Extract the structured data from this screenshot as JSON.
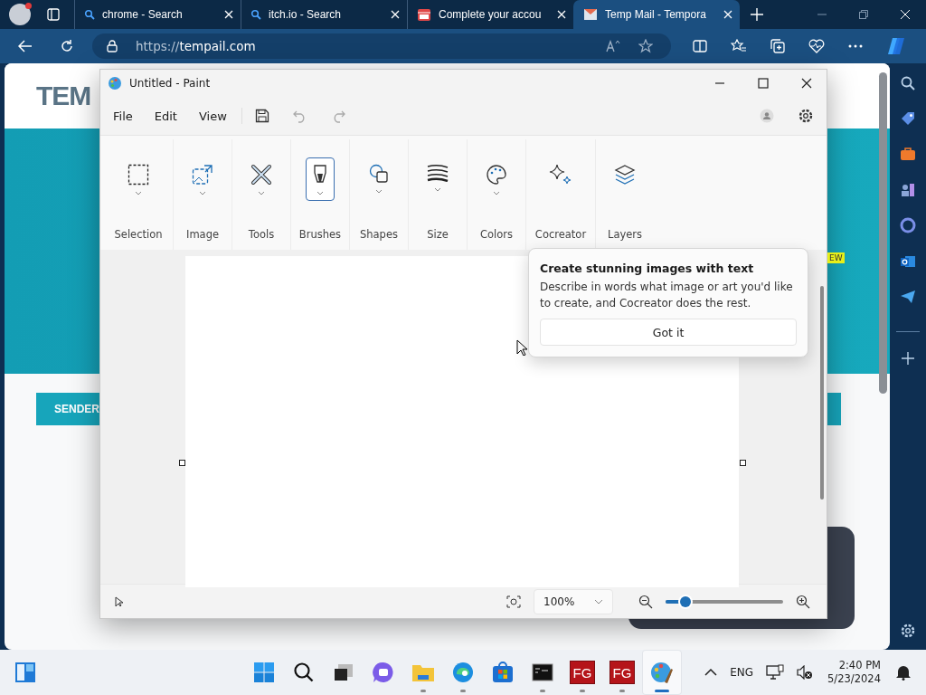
{
  "browser": {
    "tabs": [
      {
        "title": "chrome - Search",
        "kind": "search",
        "selected": false
      },
      {
        "title": "itch.io - Search",
        "kind": "search",
        "selected": false
      },
      {
        "title": "Complete your accou",
        "kind": "store",
        "selected": false
      },
      {
        "title": "Temp Mail - Tempora",
        "kind": "mail",
        "selected": true
      }
    ],
    "address": {
      "scheme": "https://",
      "host": "tempail.com"
    },
    "page": {
      "logo": "TEM",
      "column_header": "SENDER",
      "badge": "EW"
    }
  },
  "paint": {
    "title": "Untitled - Paint",
    "menu": [
      "File",
      "Edit",
      "View"
    ],
    "tools": [
      {
        "label": "Selection",
        "kind": "selection",
        "dropdown": true,
        "selected": false
      },
      {
        "label": "Image",
        "kind": "image",
        "dropdown": true,
        "selected": false
      },
      {
        "label": "Tools",
        "kind": "tools",
        "dropdown": true,
        "selected": false
      },
      {
        "label": "Brushes",
        "kind": "brushes",
        "dropdown": true,
        "selected": true
      },
      {
        "label": "Shapes",
        "kind": "shapes",
        "dropdown": true,
        "selected": false
      },
      {
        "label": "Size",
        "kind": "size",
        "dropdown": true,
        "selected": false
      },
      {
        "label": "Colors",
        "kind": "colors",
        "dropdown": true,
        "selected": false
      },
      {
        "label": "Cocreator",
        "kind": "cocreator",
        "dropdown": false,
        "selected": false
      },
      {
        "label": "Layers",
        "kind": "layers",
        "dropdown": false,
        "selected": false
      }
    ],
    "tip": {
      "title": "Create stunning images with text",
      "body": "Describe in words what image or art you'd like to create, and Cocreator does the rest.",
      "button": "Got it"
    },
    "zoom": {
      "value": "100%",
      "level": 0.17
    }
  },
  "taskbar": {
    "apps": [
      {
        "kind": "start",
        "running": false,
        "active": false
      },
      {
        "kind": "search",
        "running": false,
        "active": false
      },
      {
        "kind": "taskview",
        "running": false,
        "active": false
      },
      {
        "kind": "meet",
        "running": false,
        "active": false
      },
      {
        "kind": "explorer",
        "running": true,
        "active": false
      },
      {
        "kind": "edge",
        "running": true,
        "active": false
      },
      {
        "kind": "store",
        "running": false,
        "active": false
      },
      {
        "kind": "terminal",
        "running": true,
        "active": false
      },
      {
        "kind": "fg",
        "label": "FG",
        "running": true,
        "active": false
      },
      {
        "kind": "fg",
        "label": "FG",
        "running": true,
        "active": false
      },
      {
        "kind": "paint",
        "running": true,
        "active": true
      }
    ],
    "language": "ENG",
    "time": "2:40 PM",
    "date": "5/23/2024"
  }
}
